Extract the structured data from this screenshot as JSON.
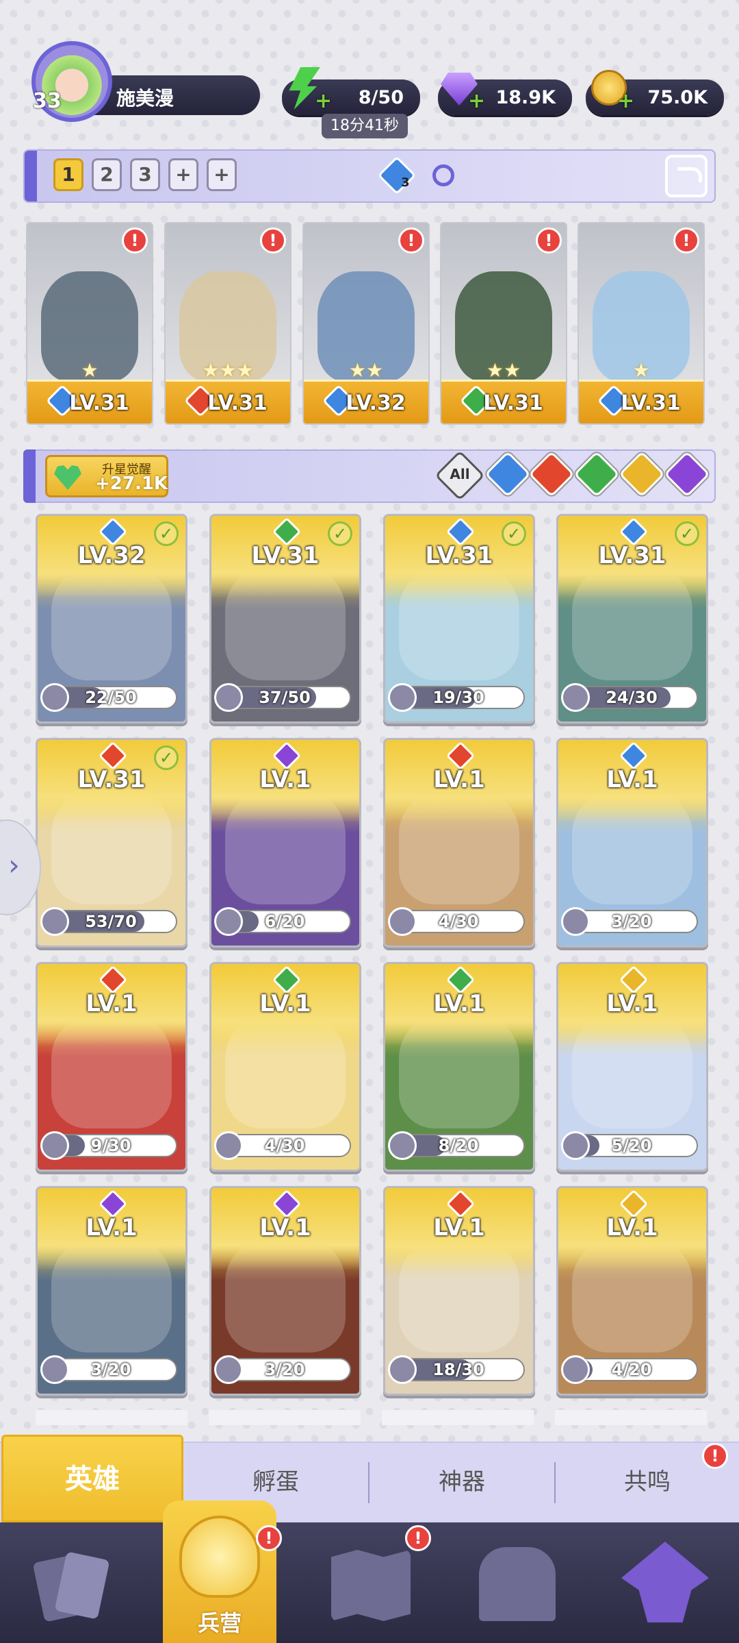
{
  "player": {
    "level": "33",
    "name": "施美漫"
  },
  "resources": {
    "energy": "8/50",
    "energy_timer": "18分41秒",
    "gems": "18.9K",
    "coins": "75.0K"
  },
  "team_tabs": [
    "1",
    "2",
    "3",
    "+",
    "+"
  ],
  "team_badge": "3",
  "team": [
    {
      "level": "LV.31",
      "element": "water",
      "stars": "★"
    },
    {
      "level": "LV.31",
      "element": "fire",
      "stars": "★★★"
    },
    {
      "level": "LV.32",
      "element": "water",
      "stars": "★★"
    },
    {
      "level": "LV.31",
      "element": "wind",
      "stars": "★★"
    },
    {
      "level": "LV.31",
      "element": "water",
      "stars": "★"
    }
  ],
  "awaken": {
    "title": "升星觉醒",
    "value": "+27.1K"
  },
  "filters": [
    "All",
    "water",
    "fire",
    "wind",
    "light",
    "dark"
  ],
  "heroes": [
    {
      "level": "LV.32",
      "element": "water",
      "shards": "22/50",
      "fill": 0.44,
      "check": true
    },
    {
      "level": "LV.31",
      "element": "wind",
      "shards": "37/50",
      "fill": 0.74,
      "check": true
    },
    {
      "level": "LV.31",
      "element": "water",
      "shards": "19/30",
      "fill": 0.63,
      "check": true
    },
    {
      "level": "LV.31",
      "element": "water",
      "shards": "24/30",
      "fill": 0.8,
      "check": true
    },
    {
      "level": "LV.31",
      "element": "fire",
      "shards": "53/70",
      "fill": 0.76,
      "check": true
    },
    {
      "level": "LV.1",
      "element": "dark",
      "shards": "6/20",
      "fill": 0.3,
      "check": false
    },
    {
      "level": "LV.1",
      "element": "fire",
      "shards": "4/30",
      "fill": 0.13,
      "check": false
    },
    {
      "level": "LV.1",
      "element": "water",
      "shards": "3/20",
      "fill": 0.15,
      "check": false
    },
    {
      "level": "LV.1",
      "element": "fire",
      "shards": "9/30",
      "fill": 0.3,
      "check": false
    },
    {
      "level": "LV.1",
      "element": "wind",
      "shards": "4/30",
      "fill": 0.13,
      "check": false
    },
    {
      "level": "LV.1",
      "element": "wind",
      "shards": "8/20",
      "fill": 0.4,
      "check": false
    },
    {
      "level": "LV.1",
      "element": "light",
      "shards": "5/20",
      "fill": 0.25,
      "check": false
    },
    {
      "level": "LV.1",
      "element": "dark",
      "shards": "3/20",
      "fill": 0.15,
      "check": false
    },
    {
      "level": "LV.1",
      "element": "dark",
      "shards": "3/20",
      "fill": 0.15,
      "check": false
    },
    {
      "level": "LV.1",
      "element": "fire",
      "shards": "18/30",
      "fill": 0.6,
      "check": false
    },
    {
      "level": "LV.1",
      "element": "light",
      "shards": "4/20",
      "fill": 0.2,
      "check": false
    }
  ],
  "sub_tabs": {
    "heroes": "英雄",
    "hatch": "孵蛋",
    "artifact": "神器",
    "resonance": "共鸣"
  },
  "bottom_nav": {
    "barracks": "兵营"
  },
  "colors": {
    "water": "#3f86e0",
    "fire": "#e2462c",
    "wind": "#3fae4a",
    "light": "#e9b52b",
    "dark": "#8a45d6",
    "accent": "#f4c93b"
  }
}
